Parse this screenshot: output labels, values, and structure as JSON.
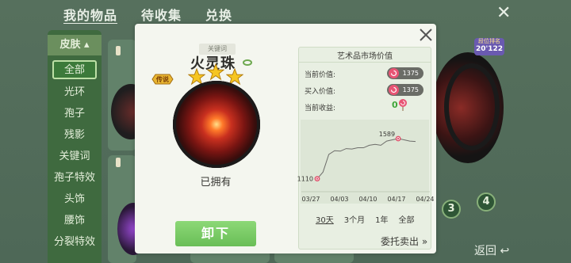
{
  "background": {
    "tabs": [
      "我的物品",
      "待收集",
      "兑换"
    ],
    "sidebar": [
      "皮肤",
      "全部",
      "光环",
      "孢子",
      "残影",
      "关键词",
      "孢子特效",
      "头饰",
      "腰饰",
      "分裂特效"
    ],
    "badge_top": "段位排名",
    "badge_bottom": "20'122",
    "numbers": [
      "3",
      "4"
    ],
    "back_label": "返回"
  },
  "modal": {
    "keyword_tag": "关键词",
    "item_name": "火灵珠",
    "legend_badge": "传说",
    "stars": 3,
    "owned_label": "已拥有",
    "unequip_label": "卸下",
    "market": {
      "title": "艺术品市场价值",
      "current_value_label": "当前价值:",
      "current_value": "1375",
      "buy_value_label": "买入价值:",
      "buy_value": "1375",
      "gain_label": "当前收益:",
      "gain_value": "0",
      "periods": [
        "30天",
        "3个月",
        "1年",
        "全部"
      ],
      "active_period": "30天",
      "consign_label": "委托卖出 »"
    }
  },
  "chart_data": {
    "type": "line",
    "x_ticks": [
      "03/27",
      "04/03",
      "04/10",
      "04/17",
      "04/24"
    ],
    "series": [
      {
        "values": [
          1110,
          1190,
          1400,
          1445,
          1440,
          1470,
          1465,
          1480,
          1480,
          1510,
          1520,
          1510,
          1560,
          1575,
          1589,
          1575,
          1560,
          1555
        ]
      }
    ],
    "min_label": "1110",
    "max_label": "1589",
    "ylim": [
      1050,
      1750
    ],
    "colors": {
      "line": "#6d6d6a",
      "marker": "#e0506b"
    }
  }
}
